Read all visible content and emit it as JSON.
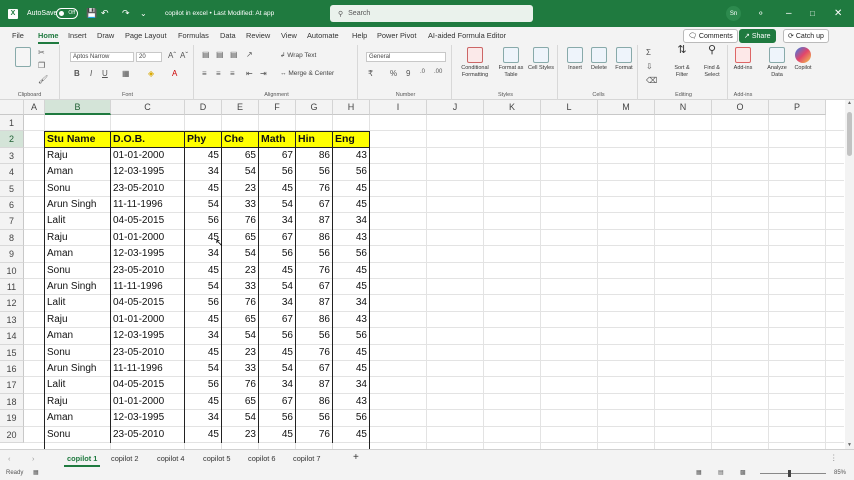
{
  "title_bar": {
    "autosave_label": "AutoSave",
    "autosave_state": "Off",
    "doc_title": "copilot in excel • Last Modified: At app",
    "search_placeholder": "Search",
    "user_initials": "Sn"
  },
  "menu": {
    "tabs": [
      "File",
      "Home",
      "Insert",
      "Draw",
      "Page Layout",
      "Formulas",
      "Data",
      "Review",
      "View",
      "Automate",
      "Help",
      "Power Pivot",
      "AI-aided Formula Editor"
    ],
    "active": "Home",
    "comments": "Comments",
    "share": "Share",
    "catchup": "Catch up"
  },
  "ribbon": {
    "clipboard": {
      "label": "Clipboard",
      "paste": "Paste"
    },
    "font": {
      "label": "Font",
      "name": "Aptos Narrow",
      "size": "20"
    },
    "alignment": {
      "label": "Alignment",
      "wrap": "Wrap Text",
      "merge": "Merge & Center"
    },
    "number": {
      "label": "Number",
      "format": "General"
    },
    "styles": {
      "label": "Styles",
      "cond": "Conditional Formatting",
      "table": "Format as Table",
      "cell": "Cell Styles"
    },
    "cells": {
      "label": "Cells",
      "insert": "Insert",
      "delete": "Delete",
      "format": "Format"
    },
    "editing": {
      "label": "Editing",
      "sort": "Sort & Filter",
      "find": "Find & Select"
    },
    "addins": {
      "label": "Add-ins",
      "addins": "Add-ins",
      "analyze": "Analyze Data",
      "copilot": "Copilot"
    }
  },
  "grid": {
    "columns": [
      "A",
      "B",
      "C",
      "D",
      "E",
      "F",
      "G",
      "H",
      "I",
      "J",
      "K",
      "L",
      "M",
      "N",
      "O",
      "P"
    ],
    "selected_column": "B",
    "selected_row": "2",
    "row_numbers": [
      "1",
      "2",
      "3",
      "4",
      "5",
      "6",
      "7",
      "8",
      "9",
      "10",
      "11",
      "12",
      "13",
      "14",
      "15",
      "16",
      "17",
      "18",
      "19",
      "20"
    ],
    "table_headers": [
      "Stu Name",
      "D.O.B.",
      "Phy",
      "Che",
      "Math",
      "Hin",
      "Eng"
    ],
    "rows": [
      [
        "Raju",
        "01-01-2000",
        "45",
        "65",
        "67",
        "86",
        "43"
      ],
      [
        "Aman",
        "12-03-1995",
        "34",
        "54",
        "56",
        "56",
        "56"
      ],
      [
        "Sonu",
        "23-05-2010",
        "45",
        "23",
        "45",
        "76",
        "45"
      ],
      [
        "Arun Singh",
        "11-11-1996",
        "54",
        "33",
        "54",
        "67",
        "45"
      ],
      [
        "Lalit",
        "04-05-2015",
        "56",
        "76",
        "34",
        "87",
        "34"
      ],
      [
        "Raju",
        "01-01-2000",
        "45",
        "65",
        "67",
        "86",
        "43"
      ],
      [
        "Aman",
        "12-03-1995",
        "34",
        "54",
        "56",
        "56",
        "56"
      ],
      [
        "Sonu",
        "23-05-2010",
        "45",
        "23",
        "45",
        "76",
        "45"
      ],
      [
        "Arun Singh",
        "11-11-1996",
        "54",
        "33",
        "54",
        "67",
        "45"
      ],
      [
        "Lalit",
        "04-05-2015",
        "56",
        "76",
        "34",
        "87",
        "34"
      ],
      [
        "Raju",
        "01-01-2000",
        "45",
        "65",
        "67",
        "86",
        "43"
      ],
      [
        "Aman",
        "12-03-1995",
        "34",
        "54",
        "56",
        "56",
        "56"
      ],
      [
        "Sonu",
        "23-05-2010",
        "45",
        "23",
        "45",
        "76",
        "45"
      ],
      [
        "Arun Singh",
        "11-11-1996",
        "54",
        "33",
        "54",
        "67",
        "45"
      ],
      [
        "Lalit",
        "04-05-2015",
        "56",
        "76",
        "34",
        "87",
        "34"
      ],
      [
        "Raju",
        "01-01-2000",
        "45",
        "65",
        "67",
        "86",
        "43"
      ],
      [
        "Aman",
        "12-03-1995",
        "34",
        "54",
        "56",
        "56",
        "56"
      ],
      [
        "Sonu",
        "23-05-2010",
        "45",
        "23",
        "45",
        "76",
        "45"
      ]
    ]
  },
  "sheets": {
    "tabs": [
      "copilot 1",
      "copilot 2",
      "copilot 4",
      "copilot 5",
      "copilot 6",
      "copilot 7"
    ],
    "active": "copilot 1",
    "add_symbol": "+"
  },
  "status": {
    "ready": "Ready",
    "zoom": "85%"
  },
  "colors": {
    "accent": "#1f7a3f",
    "header_fill": "#ffff00"
  }
}
